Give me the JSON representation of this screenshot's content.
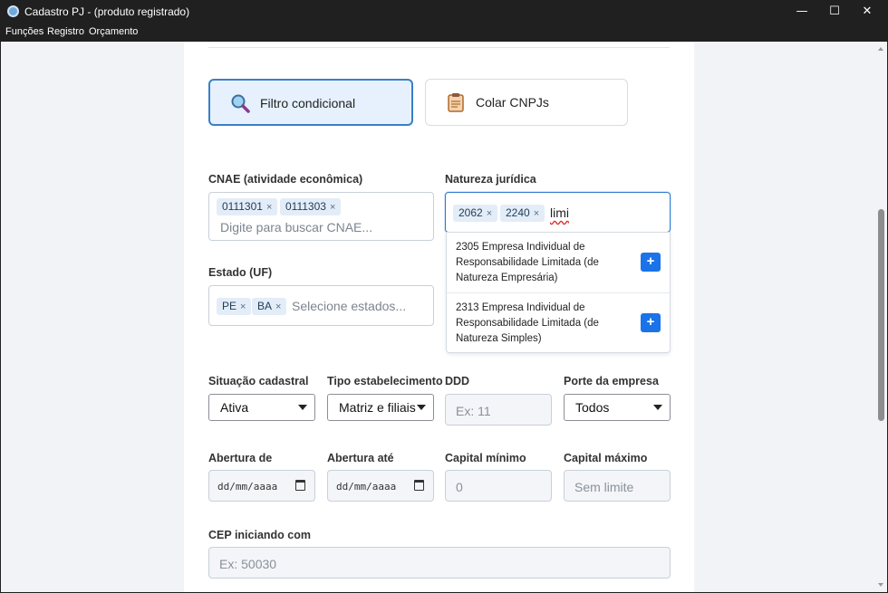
{
  "window": {
    "title": "Cadastro PJ - (produto registrado)",
    "minimize": "—",
    "maximize": "☐",
    "close": "✕"
  },
  "menu": [
    "Funções",
    "Registro",
    "Orçamento"
  ],
  "modes": {
    "filter_label": "Filtro condicional",
    "filter_icon": "magnifier-icon",
    "paste_label": "Colar CNPJs",
    "paste_icon": "clipboard-icon"
  },
  "cnae": {
    "label": "CNAE (atividade econômica)",
    "chips": [
      "0111301",
      "0111303"
    ],
    "placeholder": "Digite para buscar CNAE..."
  },
  "natureza": {
    "label": "Natureza jurídica",
    "chips": [
      "2062",
      "2240"
    ],
    "typed": "limi",
    "options": [
      {
        "code": "2305",
        "text": "2305   Empresa Individual de Responsabilidade Limitada (de Natureza Empresária)"
      },
      {
        "code": "2313",
        "text": "2313   Empresa Individual de Responsabilidade Limitada (de Natureza Simples)"
      }
    ]
  },
  "estado": {
    "label": "Estado (UF)",
    "chips": [
      "PE",
      "BA"
    ],
    "placeholder": "Selecione estados..."
  },
  "situacao": {
    "label": "Situação cadastral",
    "value": "Ativa"
  },
  "tipo": {
    "label": "Tipo estabelecimento",
    "value": "Matriz e filiais"
  },
  "ddd": {
    "label": "DDD",
    "placeholder": "Ex: 11"
  },
  "porte": {
    "label": "Porte da empresa",
    "value": "Todos"
  },
  "abertura_de": {
    "label": "Abertura de",
    "format": "dd/mm/aaaa"
  },
  "abertura_ate": {
    "label": "Abertura até",
    "format": "dd/mm/aaaa"
  },
  "capital_min": {
    "label": "Capital mínimo",
    "placeholder": "0"
  },
  "capital_max": {
    "label": "Capital máximo",
    "placeholder": "Sem limite"
  },
  "cep": {
    "label": "CEP iniciando com",
    "placeholder": "Ex: 50030"
  },
  "chip_remove": "×",
  "add_symbol": "+",
  "colors": {
    "accent": "#1a73e8",
    "active_bg": "#e6f1fd",
    "active_border": "#3a7fc8"
  }
}
